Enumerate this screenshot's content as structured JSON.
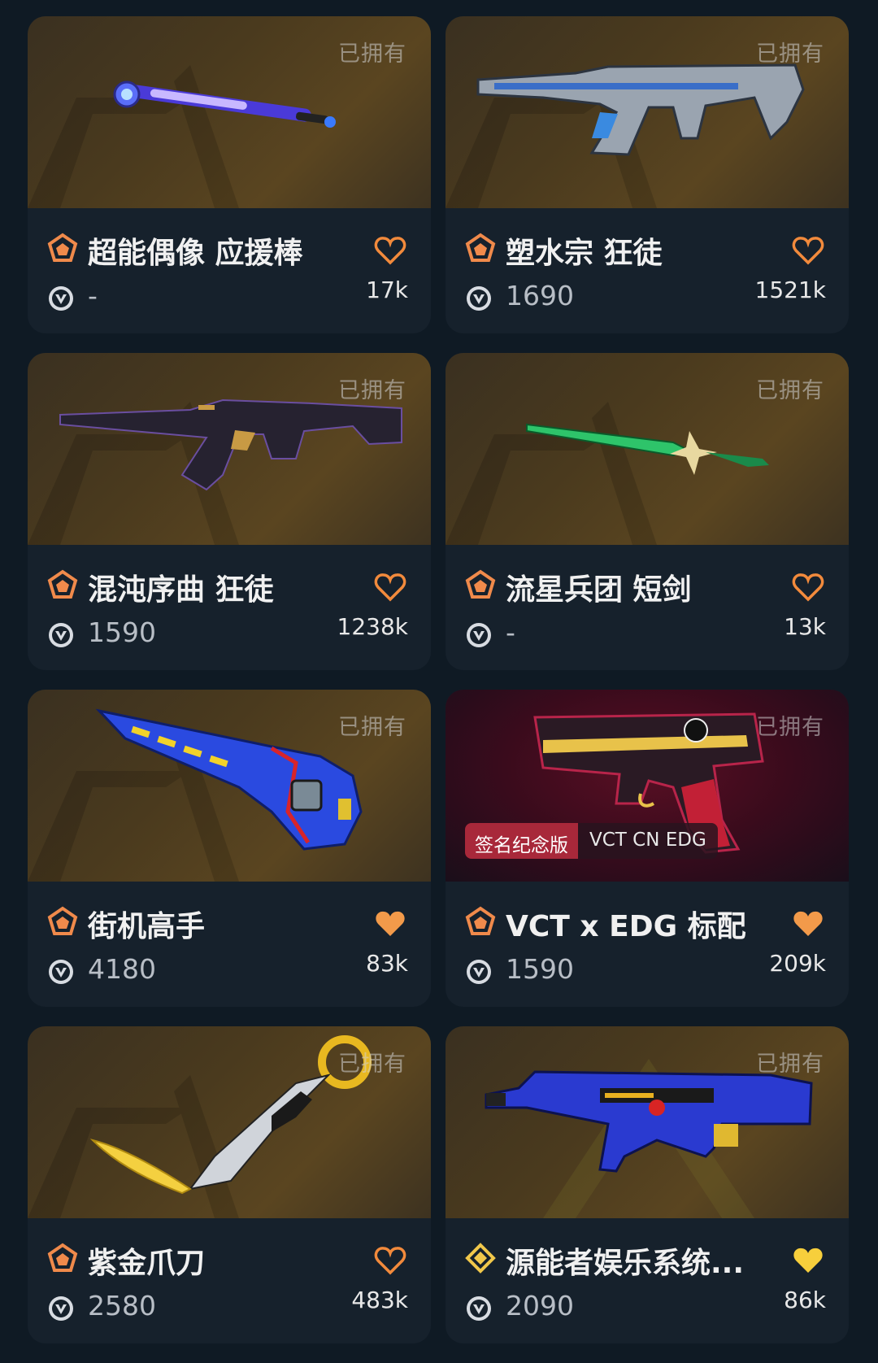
{
  "owned_label": "已拥有",
  "colors": {
    "heart_outline": "#f28a3c",
    "heart_filled_orange": "#f29a4a",
    "heart_filled_yellow": "#f7cf3c",
    "tier_orange": "#f08a4b",
    "tier_gold": "#f1c84b"
  },
  "cards": [
    {
      "name": "超能偶像 应援棒",
      "price": "-",
      "likes": "17k",
      "favorited": false,
      "tier": "premium",
      "weapon": "baton"
    },
    {
      "name": "塑水宗 狂徒",
      "price": "1690",
      "likes": "1521k",
      "favorited": false,
      "tier": "premium",
      "weapon": "vandal"
    },
    {
      "name": "混沌序曲 狂徒",
      "price": "1590",
      "likes": "1238k",
      "favorited": false,
      "tier": "premium",
      "weapon": "rifle"
    },
    {
      "name": "流星兵团 短剑",
      "price": "-",
      "likes": "13k",
      "favorited": false,
      "tier": "premium",
      "weapon": "sword"
    },
    {
      "name": "街机高手",
      "price": "4180",
      "likes": "83k",
      "favorited": true,
      "tier": "premium",
      "weapon": "arcade"
    },
    {
      "name": "VCT x EDG 标配",
      "price": "1590",
      "likes": "209k",
      "favorited": true,
      "tier": "premium",
      "weapon": "pistol",
      "badge": {
        "label": "签名纪念版",
        "team": "VCT CN EDG"
      }
    },
    {
      "name": "紫金爪刀",
      "price": "2580",
      "likes": "483k",
      "favorited": false,
      "tier": "premium",
      "weapon": "karambit"
    },
    {
      "name": "源能者娱乐系统...",
      "price": "2090",
      "likes": "86k",
      "favorited": true,
      "tier": "exclusive",
      "weapon": "smg"
    }
  ]
}
